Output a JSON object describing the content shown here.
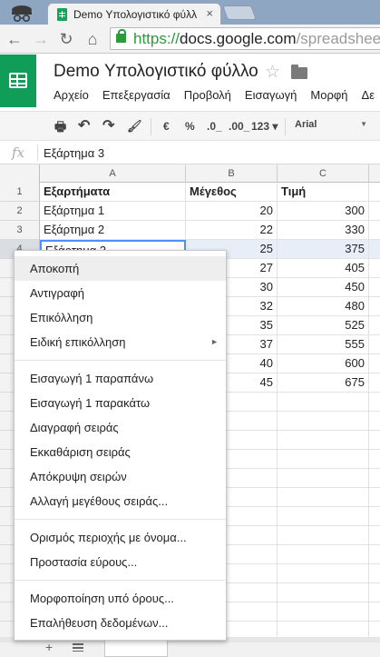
{
  "browser": {
    "tab_title": "Demo Υπολογιστικό φύλλ",
    "tab_close": "×",
    "url_scheme": "https://",
    "url_host": "docs.google.com",
    "url_path": "/spreadsheets",
    "back_icon": "←",
    "forward_icon": "→",
    "reload_icon": "↻",
    "home_icon": "⌂"
  },
  "doc": {
    "title": "Demo Υπολογιστικό φύλλο",
    "star_icon": "☆"
  },
  "menubar": {
    "items": [
      "Αρχείο",
      "Επεξεργασία",
      "Προβολή",
      "Εισαγωγή",
      "Μορφή",
      "Δε"
    ]
  },
  "format_toolbar": {
    "print_icon": "🖶",
    "undo_icon": "↶",
    "redo_icon": "↷",
    "paint_format_icon": "🖌",
    "currency": "€",
    "percent": "%",
    "decrease_decimals": ".0_",
    "increase_decimals": ".00_",
    "more_formats": "123 ▾",
    "font": "Arial",
    "font_caret": "▼"
  },
  "formula_bar": {
    "fx": "fx",
    "value": "Εξάρτημα 3"
  },
  "grid": {
    "columns": [
      "A",
      "B",
      "C"
    ],
    "rows": [
      {
        "n": "1",
        "a": "Εξαρτήματα",
        "b": "Μέγεθος",
        "c": "Τιμή"
      },
      {
        "n": "2",
        "a": "Εξάρτημα 1",
        "b": "20",
        "c": "300"
      },
      {
        "n": "3",
        "a": "Εξάρτημα 2",
        "b": "22",
        "c": "330"
      },
      {
        "n": "4",
        "a": "Εξάρτημα 3",
        "b": "25",
        "c": "375"
      },
      {
        "n": "5",
        "a": "",
        "b": "27",
        "c": "405"
      },
      {
        "n": "6",
        "a": "",
        "b": "30",
        "c": "450"
      },
      {
        "n": "7",
        "a": "",
        "b": "32",
        "c": "480"
      },
      {
        "n": "8",
        "a": "",
        "b": "35",
        "c": "525"
      },
      {
        "n": "9",
        "a": "",
        "b": "37",
        "c": "555"
      },
      {
        "n": "10",
        "a": "",
        "b": "40",
        "c": "600"
      },
      {
        "n": "11",
        "a": "",
        "b": "45",
        "c": "675"
      }
    ]
  },
  "sheet_bar": {
    "add_icon": "+"
  },
  "context_menu": {
    "groups": [
      [
        "Αποκοπή",
        "Αντιγραφή",
        "Επικόλληση",
        "Ειδική επικόλληση"
      ],
      [
        "Εισαγωγή 1 παραπάνω",
        "Εισαγωγή 1 παρακάτω",
        "Διαγραφή σειράς",
        "Εκκαθάριση σειράς",
        "Απόκρυψη σειρών",
        "Αλλαγή μεγέθους σειράς..."
      ],
      [
        "Ορισμός περιοχής με όνομα...",
        "Προστασία εύρους..."
      ],
      [
        "Μορφοποίηση υπό όρους...",
        "Επαλήθευση δεδομένων..."
      ]
    ],
    "submenu_arrow": "►"
  }
}
